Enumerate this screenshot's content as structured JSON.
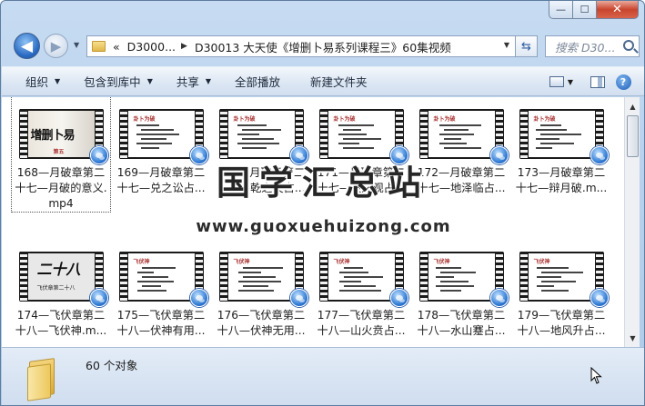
{
  "window": {
    "minimize_glyph": "—",
    "maximize_glyph": "☐",
    "close_glyph": "✕"
  },
  "nav": {
    "back_glyph": "◀",
    "forward_glyph": "▶",
    "dropdown_glyph": "▼",
    "breadcrumb_prefix": "«",
    "breadcrumb_parent": "D3000...",
    "breadcrumb_sep": "▶",
    "breadcrumb_current": "D30013 大天使《增删卜易系列课程三》60集视频",
    "refresh_glyph": "⇆",
    "search_placeholder": "搜索 D30..."
  },
  "toolbar": {
    "organize": "组织",
    "include_in_library": "包含到库中",
    "share": "共享",
    "play_all": "全部播放",
    "new_folder": "新建文件夹",
    "dropdown_glyph": "▼",
    "help_glyph": "?"
  },
  "files": [
    {
      "label": "168—月破章第二十七—月破的意义.mp4",
      "thumb": "cover",
      "cover_text": "增删卜易",
      "cover_sub": "第五"
    },
    {
      "label": "169—月破章第二十七—兑之讼占...",
      "thumb": "doc",
      "heading": "卦卜为破"
    },
    {
      "label": "170—月破章第二十七—乾之夬占...",
      "thumb": "doc",
      "heading": "卦卜为破"
    },
    {
      "label": "171—月破章第二十七—艮之观占...",
      "thumb": "doc",
      "heading": "卦卜为破"
    },
    {
      "label": "172—月破章第二十七—地泽临占...",
      "thumb": "doc",
      "heading": "卦卜为破"
    },
    {
      "label": "173—月破章第二十七—辩月破.m...",
      "thumb": "doc",
      "heading": "卦卜为破"
    },
    {
      "label": "174—飞伏章第二十八—飞伏神.m...",
      "thumb": "cover2",
      "cover_text": "二十八",
      "cover_sub": "飞伏章第二十八"
    },
    {
      "label": "175—飞伏章第二十八—伏神有用...",
      "thumb": "doc",
      "heading": "飞伏神"
    },
    {
      "label": "176—飞伏章第二十八—伏神无用...",
      "thumb": "doc",
      "heading": "飞伏神"
    },
    {
      "label": "177—飞伏章第二十八—山火贲占...",
      "thumb": "doc",
      "heading": "飞伏神"
    },
    {
      "label": "178—飞伏章第二十八—水山蹇占...",
      "thumb": "doc",
      "heading": "飞伏神"
    },
    {
      "label": "179—飞伏章第二十八—地风升占...",
      "thumb": "doc",
      "heading": "飞伏神"
    }
  ],
  "watermark": {
    "title": "国学汇总站",
    "url": "www.guoxuehuizong.com"
  },
  "status": {
    "count": "60 个对象"
  }
}
